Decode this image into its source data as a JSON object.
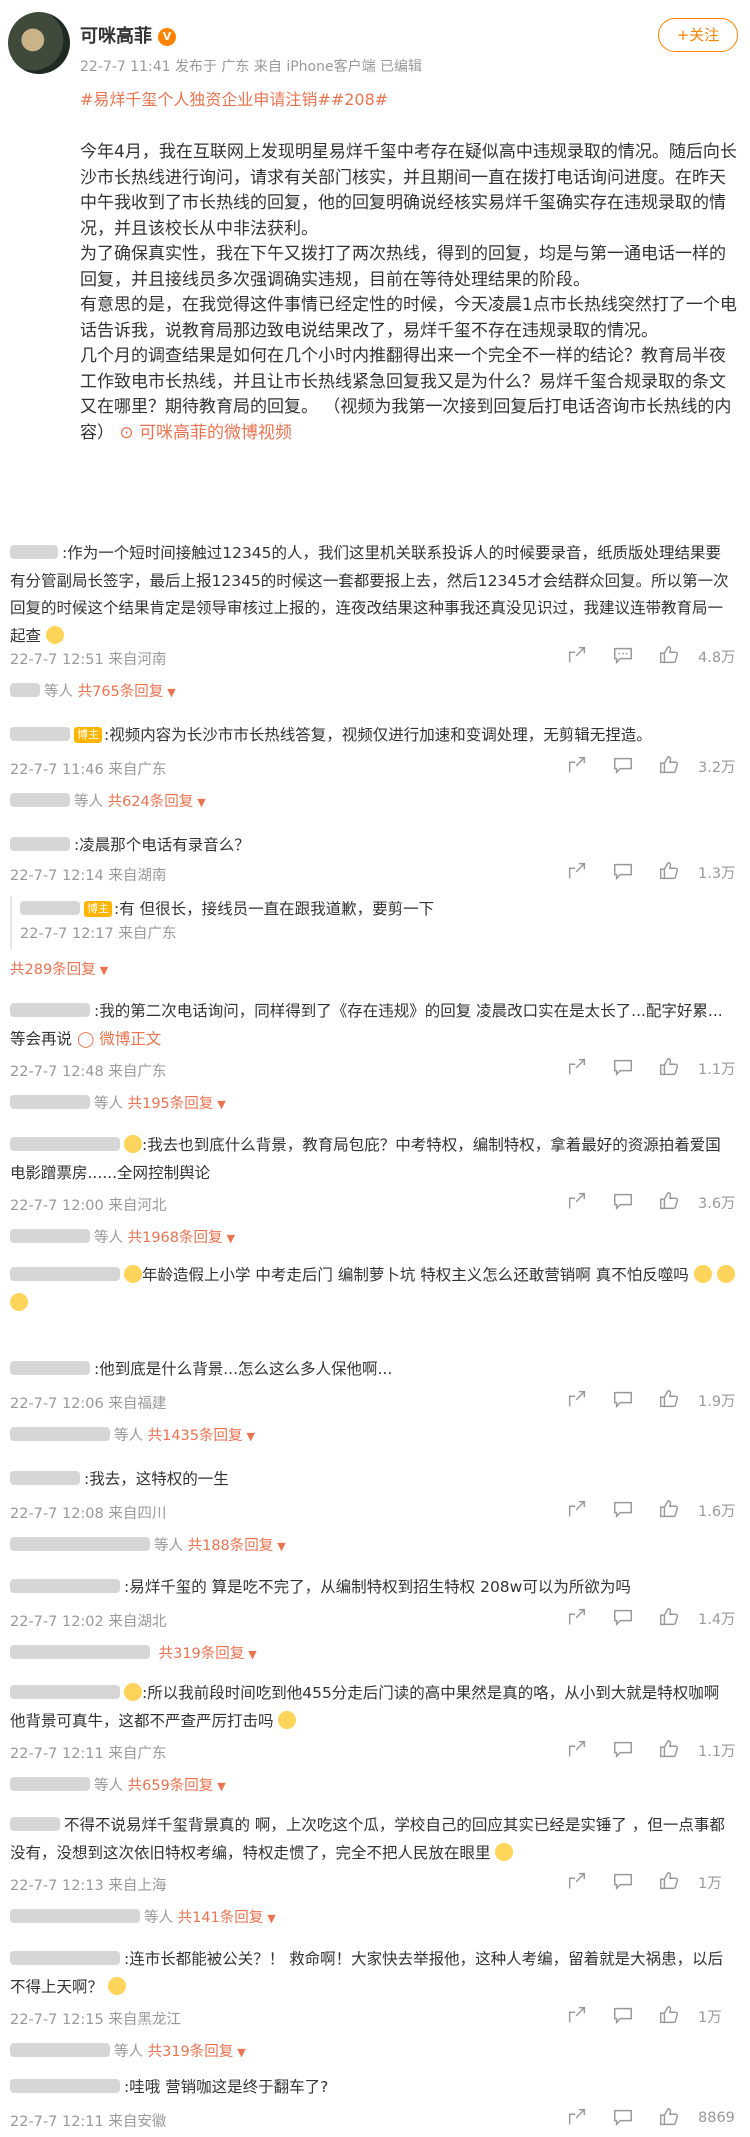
{
  "post": {
    "username": "可咪高菲",
    "vip_badge": "V",
    "meta": "22-7-7 11:41 发布于 广东 来自 iPhone客户端 已编辑",
    "follow_label": "+关注",
    "hashtag": "#易烊千玺个人独资企业申请注销##208#",
    "paragraphs": [
      "今年4月，我在互联网上发现明星易烊千玺中考存在疑似高中违规录取的情况。随后向长沙市长热线进行询问，请求有关部门核实，并且期间一直在拨打电话询问进度。在昨天中午我收到了市长热线的回复，他的回复明确说经核实易烊千玺确实存在违规录取的情况，并且该校长从中非法获利。",
      "为了确保真实性，我在下午又拨打了两次热线，得到的回复，均是与第一通电话一样的回复，并且接线员多次强调确实违规，目前在等待处理结果的阶段。",
      "有意思的是，在我觉得这件事情已经定性的时候，今天凌晨1点市长热线突然打了一个电话告诉我，说教育局那边致电说结果改了，易烊千玺不存在违规录取的情况。",
      "几个月的调查结果是如何在几个小时内推翻得出来一个完全不一样的结论？教育局半夜工作致电市长热线，并且让市长热线紧急回复我又是为什么？易烊千玺合规录取的条文又在哪里？期待教育局的回复。 （视频为我第一次接到回复后打电话咨询市长热线的内容）"
    ],
    "video_link": "可咪高菲的微博视频"
  },
  "comments": [
    {
      "text": ":作为一个短时间接触过12345的人，我们这里机关联系投诉人的时候要录音，纸质版处理结果要有分管副局长签字，最后上报12345的时候这一套都要报上去，然后12345才会结群众回复。所以第一次回复的时候这个结果肯定是领导审核过上报的，连夜改结果这种事我还真没见识过，我建议连带教育局一起查",
      "meta": "22-7-7 12:51 来自河南",
      "likes": "4.8万",
      "replies_prefix": "等人",
      "replies_count": "共765条回复"
    },
    {
      "badge": "博主",
      "text": ":视频内容为长沙市市长热线答复，视频仅进行加速和变调处理，无剪辑无捏造。",
      "meta": "22-7-7 11:46 来自广东",
      "likes": "3.2万",
      "replies_prefix": "等人",
      "replies_count": "共624条回复"
    },
    {
      "text": ":凌晨那个电话有录音么？",
      "meta": "22-7-7 12:14 来自湖南",
      "likes": "1.3万",
      "sub_badge": "博主",
      "sub_text": ":有 但很长，接线员一直在跟我道歉，要剪一下",
      "sub_meta": "22-7-7 12:17 来自广东",
      "replies_count": "共289条回复"
    },
    {
      "text": ":我的第二次电话询问，同样得到了《存在违规》的回复 凌晨改口实在是太长了...配字好累...等会再说",
      "link": "微博正文",
      "meta": "22-7-7 12:48 来自广东",
      "likes": "1.1万",
      "replies_prefix": "等人",
      "replies_count": "共195条回复"
    },
    {
      "text": ":我去也到底什么背景，教育局包庇？中考特权，编制特权，拿着最好的资源拍着爱国电影蹭票房......全网控制舆论",
      "meta": "22-7-7 12:00 来自河北",
      "likes": "3.6万",
      "replies_prefix": "等人",
      "replies_count": "共1968条回复"
    },
    {
      "text": "年龄造假上小学 中考走后门 编制萝卜坑 特权主义怎么还敢营销啊 真不怕反噬吗"
    },
    {
      "text": ":他到底是什么背景...怎么这么多人保他啊...",
      "meta": "22-7-7 12:06 来自福建",
      "likes": "1.9万",
      "replies_prefix": "等人",
      "replies_count": "共1435条回复"
    },
    {
      "text": ":我去，这特权的一生",
      "meta": "22-7-7 12:08 来自四川",
      "likes": "1.6万",
      "replies_prefix": "等人",
      "replies_count": "共188条回复"
    },
    {
      "text": ":易烊千玺的 算是吃不完了，从编制特权到招生特权 208w可以为所欲为吗",
      "meta": "22-7-7 12:02 来自湖北",
      "likes": "1.4万",
      "replies_count": "共319条回复"
    },
    {
      "text": ":所以我前段时间吃到他455分走后门读的高中果然是真的咯，从小到大就是特权咖啊 他背景可真牛，这都不严查严厉打击吗",
      "meta": "22-7-7 12:11 来自广东",
      "likes": "1.1万",
      "replies_prefix": "等人",
      "replies_count": "共659条回复"
    },
    {
      "text": "不得不说易烊千玺背景真的 啊，上次吃这个瓜，学校自己的回应其实已经是实锤了 ，但一点事都没有，没想到这次依旧特权考编，特权走惯了，完全不把人民放在眼里",
      "meta": "22-7-7 12:13 来自上海",
      "likes": "1万",
      "replies_prefix": "等人",
      "replies_count": "共141条回复"
    },
    {
      "text": ":连市长都能被公关？！ 救命啊！大家快去举报他，这种人考编，留着就是大祸患，以后不得上天啊？",
      "meta": "22-7-7 12:15 来自黑龙江",
      "likes": "1万",
      "replies_prefix": "等人",
      "replies_count": "共319条回复"
    },
    {
      "text": ":哇哦 营销咖这是终于翻车了?",
      "meta": "22-7-7 12:11 来自安徽",
      "likes": "8869"
    }
  ],
  "colors": {
    "accent": "#eb7350",
    "follow": "#ff8200",
    "meta": "#999999"
  }
}
